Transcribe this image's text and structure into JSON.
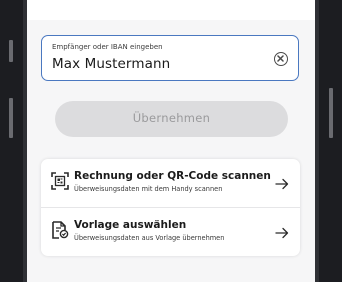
{
  "transfer_form": {
    "recipient_field": {
      "label": "Empfänger oder IBAN eingeben",
      "value": "Max Mustermann"
    },
    "submit_label": "Übernehmen",
    "options": [
      {
        "title": "Rechnung oder QR-Code scannen",
        "subtitle": "Überweisungsdaten mit dem Handy scannen",
        "icon": "qr-scan-icon"
      },
      {
        "title": "Vorlage auswählen",
        "subtitle": "Überweisungsdaten aus Vorlage übernehmen",
        "icon": "template-document-icon"
      }
    ]
  },
  "colors": {
    "focus_border": "#4a78c0",
    "disabled_button": "#dcdcde",
    "disabled_text": "#9a9a9c",
    "screen_background": "#f6f6f7",
    "device_frame": "#1c1d21"
  }
}
